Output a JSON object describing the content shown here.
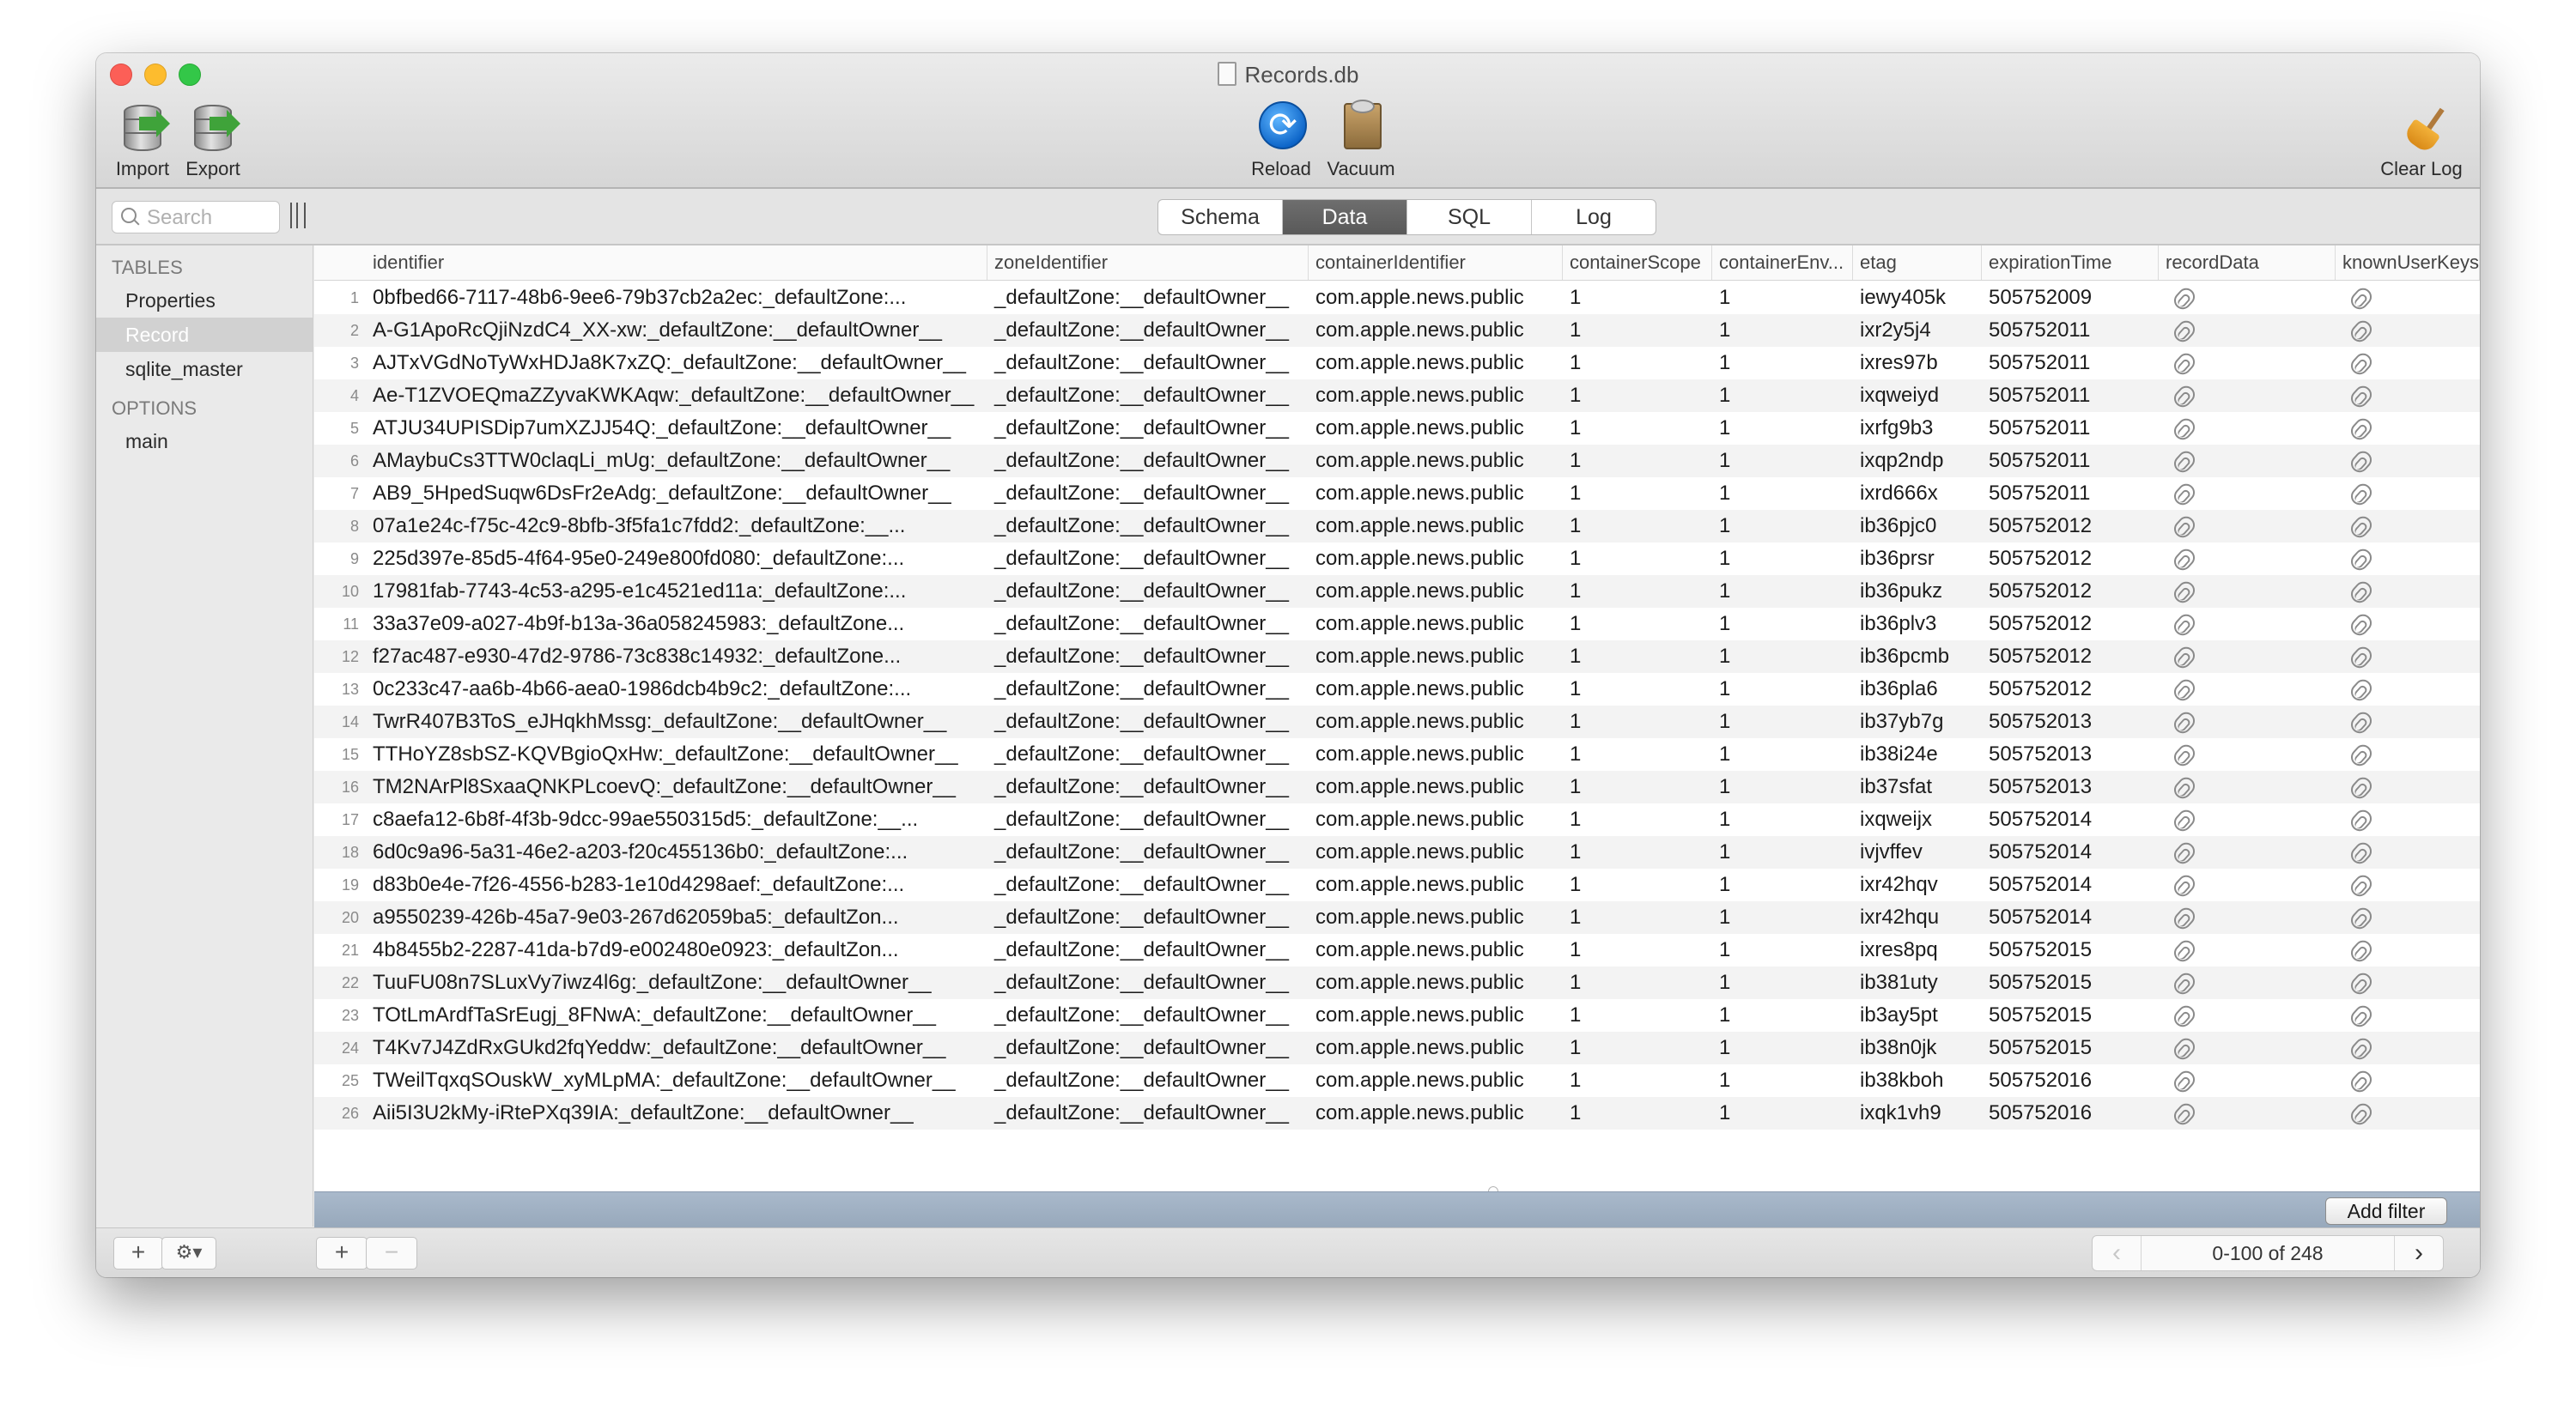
{
  "window": {
    "title": "Records.db"
  },
  "toolbar": {
    "import_label": "Import",
    "export_label": "Export",
    "reload_label": "Reload",
    "vacuum_label": "Vacuum",
    "clear_log_label": "Clear Log"
  },
  "search": {
    "placeholder": "Search"
  },
  "tabs": [
    {
      "label": "Schema",
      "active": false
    },
    {
      "label": "Data",
      "active": true
    },
    {
      "label": "SQL",
      "active": false
    },
    {
      "label": "Log",
      "active": false
    }
  ],
  "sidebar": {
    "tables_header": "TABLES",
    "tables": [
      "Properties",
      "Record",
      "sqlite_master"
    ],
    "selected_table": "Record",
    "options_header": "OPTIONS",
    "options": [
      "main"
    ]
  },
  "table": {
    "columns": [
      "identifier",
      "zoneIdentifier",
      "containerIdentifier",
      "containerScope",
      "containerEnv...",
      "etag",
      "expirationTime",
      "recordData",
      "knownUserKeys"
    ],
    "rows": [
      {
        "n": "1",
        "identifier": "0bfbed66-7117-48b6-9ee6-79b37cb2a2ec:_defaultZone:...",
        "zone": "_defaultZone:__defaultOwner__",
        "container": "com.apple.news.public",
        "scope": "1",
        "env": "1",
        "etag": "iewy405k",
        "exp": "505752009"
      },
      {
        "n": "2",
        "identifier": "A-G1ApoRcQjiNzdC4_XX-xw:_defaultZone:__defaultOwner__",
        "zone": "_defaultZone:__defaultOwner__",
        "container": "com.apple.news.public",
        "scope": "1",
        "env": "1",
        "etag": "ixr2y5j4",
        "exp": "505752011"
      },
      {
        "n": "3",
        "identifier": "AJTxVGdNoTyWxHDJa8K7xZQ:_defaultZone:__defaultOwner__",
        "zone": "_defaultZone:__defaultOwner__",
        "container": "com.apple.news.public",
        "scope": "1",
        "env": "1",
        "etag": "ixres97b",
        "exp": "505752011"
      },
      {
        "n": "4",
        "identifier": "Ae-T1ZVOEQmaZZyvaKWKAqw:_defaultZone:__defaultOwner__",
        "zone": "_defaultZone:__defaultOwner__",
        "container": "com.apple.news.public",
        "scope": "1",
        "env": "1",
        "etag": "ixqweiyd",
        "exp": "505752011"
      },
      {
        "n": "5",
        "identifier": "ATJU34UPISDip7umXZJJ54Q:_defaultZone:__defaultOwner__",
        "zone": "_defaultZone:__defaultOwner__",
        "container": "com.apple.news.public",
        "scope": "1",
        "env": "1",
        "etag": "ixrfg9b3",
        "exp": "505752011"
      },
      {
        "n": "6",
        "identifier": "AMaybuCs3TTW0claqLi_mUg:_defaultZone:__defaultOwner__",
        "zone": "_defaultZone:__defaultOwner__",
        "container": "com.apple.news.public",
        "scope": "1",
        "env": "1",
        "etag": "ixqp2ndp",
        "exp": "505752011"
      },
      {
        "n": "7",
        "identifier": "AB9_5HpedSuqw6DsFr2eAdg:_defaultZone:__defaultOwner__",
        "zone": "_defaultZone:__defaultOwner__",
        "container": "com.apple.news.public",
        "scope": "1",
        "env": "1",
        "etag": "ixrd666x",
        "exp": "505752011"
      },
      {
        "n": "8",
        "identifier": "07a1e24c-f75c-42c9-8bfb-3f5fa1c7fdd2:_defaultZone:__...",
        "zone": "_defaultZone:__defaultOwner__",
        "container": "com.apple.news.public",
        "scope": "1",
        "env": "1",
        "etag": "ib36pjc0",
        "exp": "505752012"
      },
      {
        "n": "9",
        "identifier": "225d397e-85d5-4f64-95e0-249e800fd080:_defaultZone:...",
        "zone": "_defaultZone:__defaultOwner__",
        "container": "com.apple.news.public",
        "scope": "1",
        "env": "1",
        "etag": "ib36prsr",
        "exp": "505752012"
      },
      {
        "n": "10",
        "identifier": "17981fab-7743-4c53-a295-e1c4521ed11a:_defaultZone:...",
        "zone": "_defaultZone:__defaultOwner__",
        "container": "com.apple.news.public",
        "scope": "1",
        "env": "1",
        "etag": "ib36pukz",
        "exp": "505752012"
      },
      {
        "n": "11",
        "identifier": "33a37e09-a027-4b9f-b13a-36a058245983:_defaultZone...",
        "zone": "_defaultZone:__defaultOwner__",
        "container": "com.apple.news.public",
        "scope": "1",
        "env": "1",
        "etag": "ib36plv3",
        "exp": "505752012"
      },
      {
        "n": "12",
        "identifier": "f27ac487-e930-47d2-9786-73c838c14932:_defaultZone...",
        "zone": "_defaultZone:__defaultOwner__",
        "container": "com.apple.news.public",
        "scope": "1",
        "env": "1",
        "etag": "ib36pcmb",
        "exp": "505752012"
      },
      {
        "n": "13",
        "identifier": "0c233c47-aa6b-4b66-aea0-1986dcb4b9c2:_defaultZone:...",
        "zone": "_defaultZone:__defaultOwner__",
        "container": "com.apple.news.public",
        "scope": "1",
        "env": "1",
        "etag": "ib36pla6",
        "exp": "505752012"
      },
      {
        "n": "14",
        "identifier": "TwrR407B3ToS_eJHqkhMssg:_defaultZone:__defaultOwner__",
        "zone": "_defaultZone:__defaultOwner__",
        "container": "com.apple.news.public",
        "scope": "1",
        "env": "1",
        "etag": "ib37yb7g",
        "exp": "505752013"
      },
      {
        "n": "15",
        "identifier": "TTHoYZ8sbSZ-KQVBgioQxHw:_defaultZone:__defaultOwner__",
        "zone": "_defaultZone:__defaultOwner__",
        "container": "com.apple.news.public",
        "scope": "1",
        "env": "1",
        "etag": "ib38i24e",
        "exp": "505752013"
      },
      {
        "n": "16",
        "identifier": "TM2NArPl8SxaaQNKPLcoevQ:_defaultZone:__defaultOwner__",
        "zone": "_defaultZone:__defaultOwner__",
        "container": "com.apple.news.public",
        "scope": "1",
        "env": "1",
        "etag": "ib37sfat",
        "exp": "505752013"
      },
      {
        "n": "17",
        "identifier": "c8aefa12-6b8f-4f3b-9dcc-99ae550315d5:_defaultZone:__...",
        "zone": "_defaultZone:__defaultOwner__",
        "container": "com.apple.news.public",
        "scope": "1",
        "env": "1",
        "etag": "ixqweijx",
        "exp": "505752014"
      },
      {
        "n": "18",
        "identifier": "6d0c9a96-5a31-46e2-a203-f20c455136b0:_defaultZone:...",
        "zone": "_defaultZone:__defaultOwner__",
        "container": "com.apple.news.public",
        "scope": "1",
        "env": "1",
        "etag": "ivjvffev",
        "exp": "505752014"
      },
      {
        "n": "19",
        "identifier": "d83b0e4e-7f26-4556-b283-1e10d4298aef:_defaultZone:...",
        "zone": "_defaultZone:__defaultOwner__",
        "container": "com.apple.news.public",
        "scope": "1",
        "env": "1",
        "etag": "ixr42hqv",
        "exp": "505752014"
      },
      {
        "n": "20",
        "identifier": "a9550239-426b-45a7-9e03-267d62059ba5:_defaultZon...",
        "zone": "_defaultZone:__defaultOwner__",
        "container": "com.apple.news.public",
        "scope": "1",
        "env": "1",
        "etag": "ixr42hqu",
        "exp": "505752014"
      },
      {
        "n": "21",
        "identifier": "4b8455b2-2287-41da-b7d9-e002480e0923:_defaultZon...",
        "zone": "_defaultZone:__defaultOwner__",
        "container": "com.apple.news.public",
        "scope": "1",
        "env": "1",
        "etag": "ixres8pq",
        "exp": "505752015"
      },
      {
        "n": "22",
        "identifier": "TuuFU08n7SLuxVy7iwz4l6g:_defaultZone:__defaultOwner__",
        "zone": "_defaultZone:__defaultOwner__",
        "container": "com.apple.news.public",
        "scope": "1",
        "env": "1",
        "etag": "ib381uty",
        "exp": "505752015"
      },
      {
        "n": "23",
        "identifier": "TOtLmArdfTaSrEugj_8FNwA:_defaultZone:__defaultOwner__",
        "zone": "_defaultZone:__defaultOwner__",
        "container": "com.apple.news.public",
        "scope": "1",
        "env": "1",
        "etag": "ib3ay5pt",
        "exp": "505752015"
      },
      {
        "n": "24",
        "identifier": "T4Kv7J4ZdRxGUkd2fqYeddw:_defaultZone:__defaultOwner__",
        "zone": "_defaultZone:__defaultOwner__",
        "container": "com.apple.news.public",
        "scope": "1",
        "env": "1",
        "etag": "ib38n0jk",
        "exp": "505752015"
      },
      {
        "n": "25",
        "identifier": "TWeilTqxqSOuskW_xyMLpMA:_defaultZone:__defaultOwner__",
        "zone": "_defaultZone:__defaultOwner__",
        "container": "com.apple.news.public",
        "scope": "1",
        "env": "1",
        "etag": "ib38kboh",
        "exp": "505752016"
      },
      {
        "n": "26",
        "identifier": "Aii5I3U2kMy-iRtePXq39IA:_defaultZone:__defaultOwner__",
        "zone": "_defaultZone:__defaultOwner__",
        "container": "com.apple.news.public",
        "scope": "1",
        "env": "1",
        "etag": "ixqk1vh9",
        "exp": "505752016"
      }
    ]
  },
  "filter": {
    "add_filter_label": "Add filter"
  },
  "bottom": {
    "add_label": "+",
    "remove_label": "−",
    "gear_label": "⚙▾",
    "pager_label": "0-100 of 248",
    "prev_label": "‹",
    "next_label": "›"
  },
  "icons": {
    "record_data": "paperclip-icon",
    "known_user_keys": "paperclip-icon"
  }
}
